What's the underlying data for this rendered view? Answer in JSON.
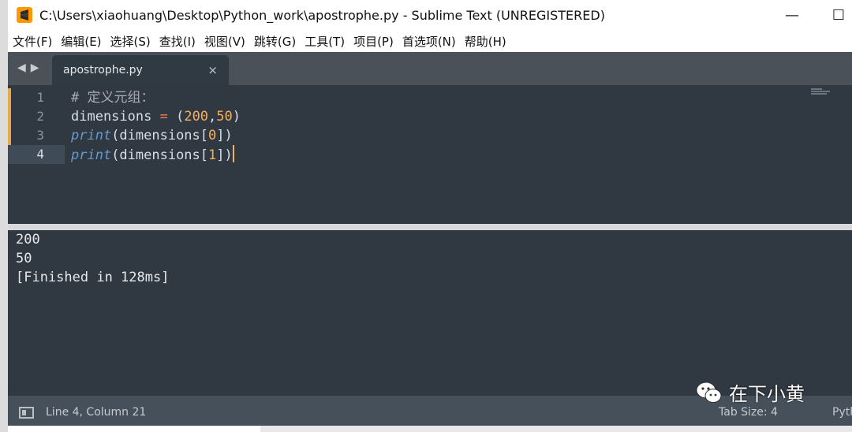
{
  "window": {
    "title": "C:\\Users\\xiaohuang\\Desktop\\Python_work\\apostrophe.py - Sublime Text (UNREGISTERED)",
    "minimize_glyph": "—",
    "maximize_glyph": "☐"
  },
  "menu": {
    "items": [
      "文件(F)",
      "编辑(E)",
      "选择(S)",
      "查找(I)",
      "视图(V)",
      "跳转(G)",
      "工具(T)",
      "项目(P)",
      "首选项(N)",
      "帮助(H)"
    ]
  },
  "tabs": {
    "nav_back": "◀",
    "nav_forward": "▶",
    "active": {
      "label": "apostrophe.py",
      "close": "×"
    }
  },
  "editor": {
    "line_numbers": [
      "1",
      "2",
      "3",
      "4"
    ],
    "active_line": 4,
    "code": {
      "l1_comment": "# 定义元组：",
      "l2_var": "dimensions",
      "l2_eq": " = ",
      "l2_open": "(",
      "l2_n1": "200",
      "l2_comma": ",",
      "l2_n2": "50",
      "l2_close": ")",
      "l3_fn": "print",
      "l3_mid": "(dimensions[",
      "l3_idx": "0",
      "l3_end": "])",
      "l4_fn": "print",
      "l4_mid": "(dimensions[",
      "l4_idx": "1",
      "l4_end": "])"
    }
  },
  "output": {
    "lines": [
      "200",
      "50",
      "[Finished in 128ms]"
    ]
  },
  "status": {
    "position": "Line 4, Column 21",
    "tab_size": "Tab Size: 4",
    "syntax": "Python"
  },
  "watermark": {
    "text": "在下小黄",
    "icon": "wechat-icon"
  },
  "colors": {
    "editor_bg": "#303841",
    "tabbar_bg": "#4a5158",
    "status_bg": "#45505a",
    "accent": "#f9ae58",
    "keyword_blue": "#6699cc",
    "operator": "#f97b58"
  }
}
